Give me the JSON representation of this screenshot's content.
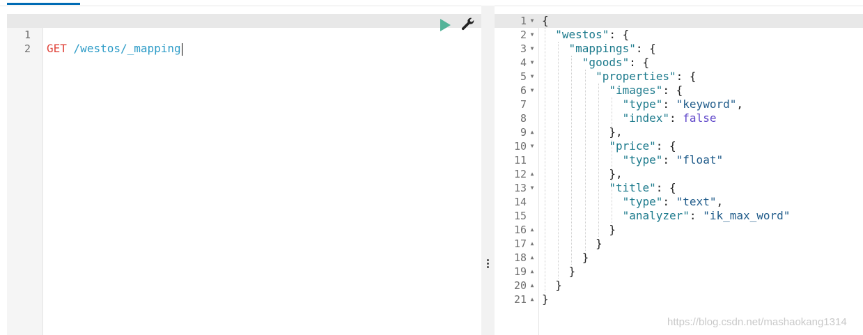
{
  "request": {
    "lines": [
      {
        "number": "1",
        "method": "GET",
        "path": "/westos/_mapping"
      },
      {
        "number": "2",
        "method": "",
        "path": ""
      }
    ],
    "run_label": "Send request",
    "settings_label": "Request settings"
  },
  "response": {
    "lines": [
      {
        "number": "1",
        "fold": "▼",
        "parts": [
          [
            "punct",
            "{"
          ]
        ]
      },
      {
        "number": "2",
        "fold": "▼",
        "parts": [
          [
            "punct",
            "  "
          ],
          [
            "key",
            "\"westos\""
          ],
          [
            "punct",
            ": {"
          ]
        ]
      },
      {
        "number": "3",
        "fold": "▼",
        "parts": [
          [
            "punct",
            "    "
          ],
          [
            "key",
            "\"mappings\""
          ],
          [
            "punct",
            ": {"
          ]
        ]
      },
      {
        "number": "4",
        "fold": "▼",
        "parts": [
          [
            "punct",
            "      "
          ],
          [
            "key",
            "\"goods\""
          ],
          [
            "punct",
            ": {"
          ]
        ]
      },
      {
        "number": "5",
        "fold": "▼",
        "parts": [
          [
            "punct",
            "        "
          ],
          [
            "key",
            "\"properties\""
          ],
          [
            "punct",
            ": {"
          ]
        ]
      },
      {
        "number": "6",
        "fold": "▼",
        "parts": [
          [
            "punct",
            "          "
          ],
          [
            "key",
            "\"images\""
          ],
          [
            "punct",
            ": {"
          ]
        ]
      },
      {
        "number": "7",
        "fold": "",
        "parts": [
          [
            "punct",
            "            "
          ],
          [
            "key",
            "\"type\""
          ],
          [
            "punct",
            ": "
          ],
          [
            "str",
            "\"keyword\""
          ],
          [
            "punct",
            ","
          ]
        ]
      },
      {
        "number": "8",
        "fold": "",
        "parts": [
          [
            "punct",
            "            "
          ],
          [
            "key",
            "\"index\""
          ],
          [
            "punct",
            ": "
          ],
          [
            "bool",
            "false"
          ]
        ]
      },
      {
        "number": "9",
        "fold": "▲",
        "parts": [
          [
            "punct",
            "          },"
          ]
        ]
      },
      {
        "number": "10",
        "fold": "▼",
        "parts": [
          [
            "punct",
            "          "
          ],
          [
            "key",
            "\"price\""
          ],
          [
            "punct",
            ": {"
          ]
        ]
      },
      {
        "number": "11",
        "fold": "",
        "parts": [
          [
            "punct",
            "            "
          ],
          [
            "key",
            "\"type\""
          ],
          [
            "punct",
            ": "
          ],
          [
            "str",
            "\"float\""
          ]
        ]
      },
      {
        "number": "12",
        "fold": "▲",
        "parts": [
          [
            "punct",
            "          },"
          ]
        ]
      },
      {
        "number": "13",
        "fold": "▼",
        "parts": [
          [
            "punct",
            "          "
          ],
          [
            "key",
            "\"title\""
          ],
          [
            "punct",
            ": {"
          ]
        ]
      },
      {
        "number": "14",
        "fold": "",
        "parts": [
          [
            "punct",
            "            "
          ],
          [
            "key",
            "\"type\""
          ],
          [
            "punct",
            ": "
          ],
          [
            "str",
            "\"text\""
          ],
          [
            "punct",
            ","
          ]
        ]
      },
      {
        "number": "15",
        "fold": "",
        "parts": [
          [
            "punct",
            "            "
          ],
          [
            "key",
            "\"analyzer\""
          ],
          [
            "punct",
            ": "
          ],
          [
            "str",
            "\"ik_max_word\""
          ]
        ]
      },
      {
        "number": "16",
        "fold": "▲",
        "parts": [
          [
            "punct",
            "          }"
          ]
        ]
      },
      {
        "number": "17",
        "fold": "▲",
        "parts": [
          [
            "punct",
            "        }"
          ]
        ]
      },
      {
        "number": "18",
        "fold": "▲",
        "parts": [
          [
            "punct",
            "      }"
          ]
        ]
      },
      {
        "number": "19",
        "fold": "▲",
        "parts": [
          [
            "punct",
            "    }"
          ]
        ]
      },
      {
        "number": "20",
        "fold": "▲",
        "parts": [
          [
            "punct",
            "  }"
          ]
        ]
      },
      {
        "number": "21",
        "fold": "▲",
        "parts": [
          [
            "punct",
            "}"
          ]
        ]
      }
    ]
  },
  "watermark": "https://blog.csdn.net/mashaokang1314",
  "colors": {
    "accent": "#006bb4",
    "run": "#54b399"
  }
}
